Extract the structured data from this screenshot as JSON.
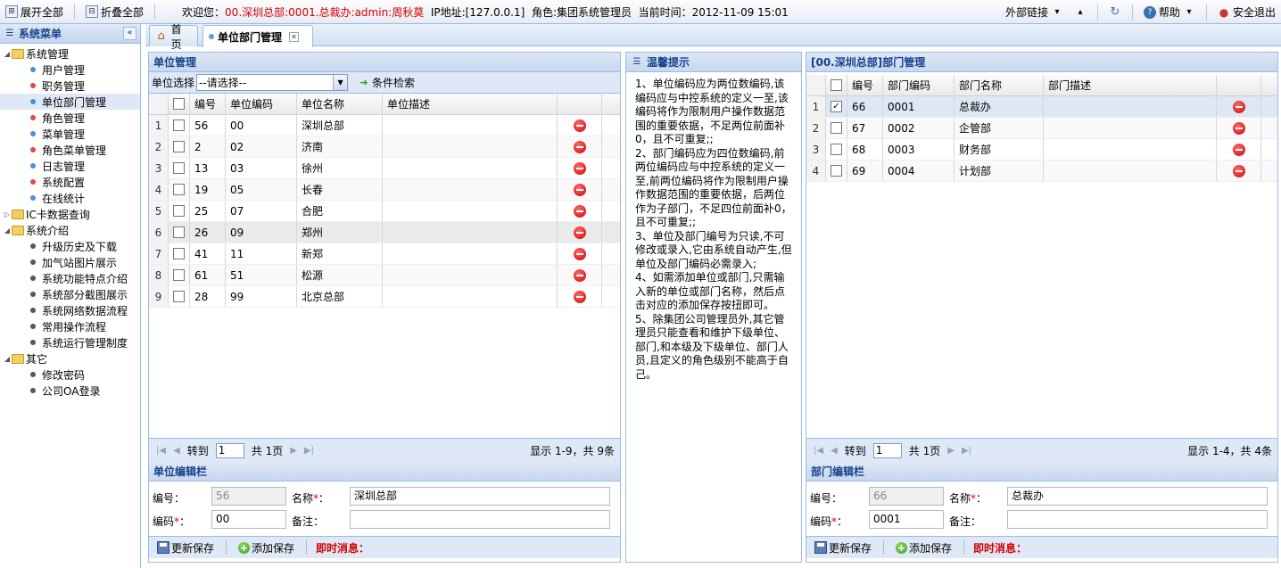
{
  "topbar": {
    "expand_all": "展开全部",
    "collapse_all": "折叠全部",
    "welcome_label": "欢迎您：",
    "user": "00.深圳总部:0001.总裁办:admin:周秋莫",
    "ip": "IP地址:[127.0.0.1]",
    "role": "角色:集团系统管理员",
    "time": "当前时间：2012-11-09 15:01",
    "external_links": "外部链接",
    "help": "帮助",
    "logout": "安全退出"
  },
  "tabs": {
    "home": "首页",
    "active": "单位部门管理"
  },
  "sidebar": {
    "title": "系统菜单",
    "groups": [
      {
        "label": "系统管理",
        "items": [
          "用户管理",
          "职务管理",
          "单位部门管理",
          "角色管理",
          "菜单管理",
          "角色菜单管理",
          "日志管理",
          "系统配置",
          "在线统计"
        ]
      },
      {
        "label": "IC卡数据查询",
        "items": []
      },
      {
        "label": "系统介绍",
        "items": [
          "升级历史及下载",
          "加气站图片展示",
          "系统功能特点介绍",
          "系统部分截图展示",
          "系统网络数据流程",
          "常用操作流程",
          "系统运行管理制度"
        ]
      },
      {
        "label": "其它",
        "items": [
          "修改密码",
          "公司OA登录"
        ]
      }
    ]
  },
  "unit_panel": {
    "title": "单位管理",
    "select_label": "单位选择",
    "select_value": "--请选择--",
    "search_label": "条件检索",
    "columns": [
      "编号",
      "单位编码",
      "单位名称",
      "单位描述"
    ],
    "rows": [
      {
        "n": "1",
        "id": "56",
        "code": "00",
        "name": "深圳总部",
        "desc": ""
      },
      {
        "n": "2",
        "id": "2",
        "code": "02",
        "name": "济南",
        "desc": ""
      },
      {
        "n": "3",
        "id": "13",
        "code": "03",
        "name": "徐州",
        "desc": ""
      },
      {
        "n": "4",
        "id": "19",
        "code": "05",
        "name": "长春",
        "desc": ""
      },
      {
        "n": "5",
        "id": "25",
        "code": "07",
        "name": "合肥",
        "desc": ""
      },
      {
        "n": "6",
        "id": "26",
        "code": "09",
        "name": "郑州",
        "desc": ""
      },
      {
        "n": "7",
        "id": "41",
        "code": "11",
        "name": "新郑",
        "desc": ""
      },
      {
        "n": "8",
        "id": "61",
        "code": "51",
        "name": "松源",
        "desc": ""
      },
      {
        "n": "9",
        "id": "28",
        "code": "99",
        "name": "北京总部",
        "desc": ""
      }
    ],
    "pager": {
      "goto": "转到",
      "page": "1",
      "total": "共 1页",
      "display": "显示 1-9，共 9条"
    },
    "form": {
      "title": "单位编辑栏",
      "id_label": "编号：",
      "id_value": "56",
      "name_label": "名称",
      "name_value": "深圳总部",
      "code_label": "编码",
      "code_value": "00",
      "remark_label": "备注：",
      "remark_value": "",
      "update": "更新保存",
      "add": "添加保存",
      "msg": "即时消息："
    }
  },
  "tips": {
    "title": "温馨提示",
    "items": [
      "1、单位编码应为两位数编码,该编码应与中控系统的定义一至,该编码将作为限制用户操作数据范围的重要依据，不足两位前面补0，且不可重复;;",
      "2、部门编码应为四位数编码,前两位编码应与中控系统的定义一至,前两位编码将作为限制用户操作数据范围的重要依据，后两位作为子部门，不足四位前面补0，且不可重复;;",
      "3、单位及部门编号为只读,不可修改或录入,它由系统自动产生,但单位及部门编码必需录入;",
      "4、如需添加单位或部门,只需输入新的单位或部门名称，然后点击对应的添加保存按扭即可。",
      "5、除集团公司管理员外,其它管理员只能查看和维护下级单位、部门,和本级及下级单位、部门人员,且定义的角色级别不能高于自己。"
    ]
  },
  "dept_panel": {
    "title": "[00.深圳总部]部门管理",
    "columns": [
      "编号",
      "部门编码",
      "部门名称",
      "部门描述"
    ],
    "rows": [
      {
        "n": "1",
        "id": "66",
        "code": "0001",
        "name": "总裁办",
        "desc": "",
        "checked": true
      },
      {
        "n": "2",
        "id": "67",
        "code": "0002",
        "name": "企管部",
        "desc": "",
        "checked": false
      },
      {
        "n": "3",
        "id": "68",
        "code": "0003",
        "name": "财务部",
        "desc": "",
        "checked": false
      },
      {
        "n": "4",
        "id": "69",
        "code": "0004",
        "name": "计划部",
        "desc": "",
        "checked": false
      }
    ],
    "pager": {
      "goto": "转到",
      "page": "1",
      "total": "共 1页",
      "display": "显示 1-4，共 4条"
    },
    "form": {
      "title": "部门编辑栏",
      "id_label": "编号：",
      "id_value": "66",
      "name_label": "名称",
      "name_value": "总裁办",
      "code_label": "编码",
      "code_value": "0001",
      "remark_label": "备注：",
      "remark_value": "",
      "update": "更新保存",
      "add": "添加保存",
      "msg": "即时消息："
    }
  }
}
